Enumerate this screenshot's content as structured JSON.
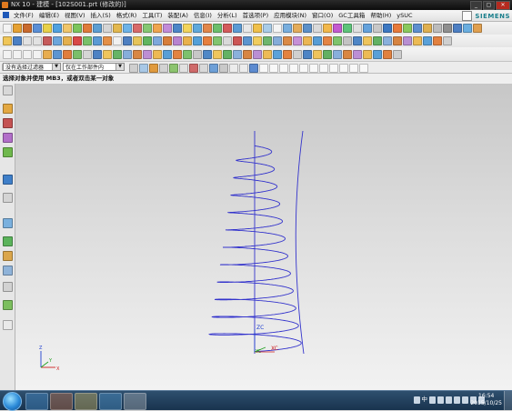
{
  "window": {
    "title": "NX 10 - 建模 - [102S001.prt (修改的)]",
    "brand": "SIEMENS"
  },
  "menu": {
    "items": [
      "文件(F)",
      "编辑(E)",
      "视图(V)",
      "插入(S)",
      "格式(R)",
      "工具(T)",
      "装配(A)",
      "信息(I)",
      "分析(L)",
      "首选项(P)",
      "应用模块(N)",
      "窗口(O)",
      "GC工具箱",
      "帮助(H)",
      "ySUC"
    ]
  },
  "selection": {
    "filter_value": "没有选择过滤器",
    "scope_value": "仅在工作部件内"
  },
  "status": {
    "prompt": "选择对象并使用 MB3，或者双击某一对象"
  },
  "viewport": {
    "wcs_labels": {
      "z": "ZC",
      "y": "YC",
      "x": "XC"
    },
    "triad_labels": {
      "z": "Z",
      "y": "Y",
      "x": "X"
    },
    "curve_color": "#3333cc"
  },
  "taskbar": {
    "language": "中",
    "time": "16:54",
    "date": "2015/10/25"
  },
  "colors": {
    "titlebar": "#0c0c0c",
    "taskbar": "#18334e",
    "wcs_x": "#d02020",
    "wcs_y": "#20a020",
    "wcs_z": "#2040d0"
  }
}
